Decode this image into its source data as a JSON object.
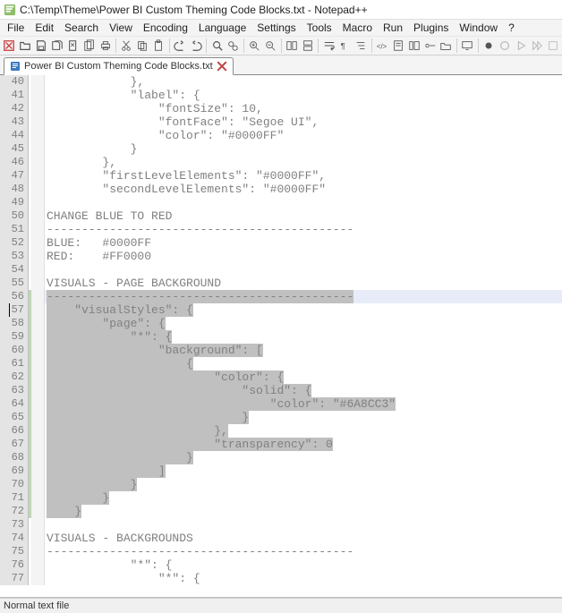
{
  "window": {
    "title": "C:\\Temp\\Theme\\Power BI Custom Theming Code Blocks.txt - Notepad++"
  },
  "menu": {
    "items": [
      "File",
      "Edit",
      "Search",
      "View",
      "Encoding",
      "Language",
      "Settings",
      "Tools",
      "Macro",
      "Run",
      "Plugins",
      "Window",
      "?"
    ]
  },
  "tab": {
    "label": "Power BI Custom Theming Code Blocks.txt"
  },
  "lines": [
    {
      "n": 40,
      "indent": 12,
      "text": "},"
    },
    {
      "n": 41,
      "indent": 12,
      "text": "\"label\": {"
    },
    {
      "n": 42,
      "indent": 16,
      "text": "\"fontSize\": 10,"
    },
    {
      "n": 43,
      "indent": 16,
      "text": "\"fontFace\": \"Segoe UI\","
    },
    {
      "n": 44,
      "indent": 16,
      "text": "\"color\": \"#0000FF\""
    },
    {
      "n": 45,
      "indent": 12,
      "text": "}"
    },
    {
      "n": 46,
      "indent": 8,
      "text": "},"
    },
    {
      "n": 47,
      "indent": 8,
      "text": "\"firstLevelElements\": \"#0000FF\","
    },
    {
      "n": 48,
      "indent": 8,
      "text": "\"secondLevelElements\": \"#0000FF\""
    },
    {
      "n": 49,
      "indent": 0,
      "text": ""
    },
    {
      "n": 50,
      "indent": 0,
      "text": "CHANGE BLUE TO RED"
    },
    {
      "n": 51,
      "indent": 0,
      "text": "--------------------------------------------"
    },
    {
      "n": 52,
      "indent": 0,
      "text": "BLUE:   #0000FF"
    },
    {
      "n": 53,
      "indent": 0,
      "text": "RED:    #FF0000"
    },
    {
      "n": 54,
      "indent": 0,
      "text": ""
    },
    {
      "n": 55,
      "indent": 0,
      "text": "VISUALS - PAGE BACKGROUND"
    },
    {
      "n": 56,
      "indent": 0,
      "text": "--------------------------------------------",
      "sel": true,
      "hl": true
    },
    {
      "n": 57,
      "indent": 4,
      "text": "\"visualStyles\": {",
      "sel": true
    },
    {
      "n": 58,
      "indent": 8,
      "text": "\"page\": {",
      "sel": true
    },
    {
      "n": 59,
      "indent": 12,
      "text": "\"*\": {",
      "sel": true
    },
    {
      "n": 60,
      "indent": 16,
      "text": "\"background\": [",
      "sel": true
    },
    {
      "n": 61,
      "indent": 20,
      "text": "{",
      "sel": true
    },
    {
      "n": 62,
      "indent": 24,
      "text": "\"color\": {",
      "sel": true
    },
    {
      "n": 63,
      "indent": 28,
      "text": "\"solid\": {",
      "sel": true
    },
    {
      "n": 64,
      "indent": 32,
      "text": "\"color\": \"#6A8CC3\"",
      "sel": true
    },
    {
      "n": 65,
      "indent": 28,
      "text": "}",
      "sel": true
    },
    {
      "n": 66,
      "indent": 24,
      "text": "},",
      "sel": true
    },
    {
      "n": 67,
      "indent": 24,
      "text": "\"transparency\": 0",
      "sel": true
    },
    {
      "n": 68,
      "indent": 20,
      "text": "}",
      "sel": true
    },
    {
      "n": 69,
      "indent": 16,
      "text": "]",
      "sel": true
    },
    {
      "n": 70,
      "indent": 12,
      "text": "}",
      "sel": true
    },
    {
      "n": 71,
      "indent": 8,
      "text": "}",
      "sel": true
    },
    {
      "n": 72,
      "indent": 4,
      "text": "}",
      "sel": true
    },
    {
      "n": 73,
      "indent": 0,
      "text": ""
    },
    {
      "n": 74,
      "indent": 0,
      "text": "VISUALS - BACKGROUNDS"
    },
    {
      "n": 75,
      "indent": 0,
      "text": "--------------------------------------------"
    },
    {
      "n": 76,
      "indent": 12,
      "text": "\"*\": {"
    },
    {
      "n": 77,
      "indent": 16,
      "text": "\"*\": {"
    }
  ],
  "status": {
    "text": "Normal text file"
  }
}
